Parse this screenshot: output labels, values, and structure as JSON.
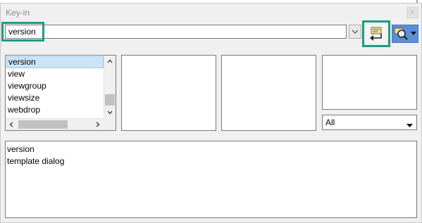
{
  "window": {
    "title": "Key-in",
    "close_glyph": "×"
  },
  "keyin": {
    "value": "version",
    "dropdown_icon": "chevron-down-icon"
  },
  "toolbar": {
    "apply_icon": "keyin-apply-icon",
    "browse_icon": "search-browser-icon",
    "browse_menu_icon": "dropdown-arrow-icon"
  },
  "word_list": {
    "items": [
      "version",
      "view",
      "viewgroup",
      "viewsize",
      "webdrop"
    ],
    "selected_index": 0
  },
  "filter": {
    "value": "All"
  },
  "history": {
    "lines": [
      "version",
      "template dialog"
    ]
  },
  "colors": {
    "highlight": "#1e9c84",
    "selection": "#cce4f7",
    "browse_button": "#5b8fd6"
  }
}
